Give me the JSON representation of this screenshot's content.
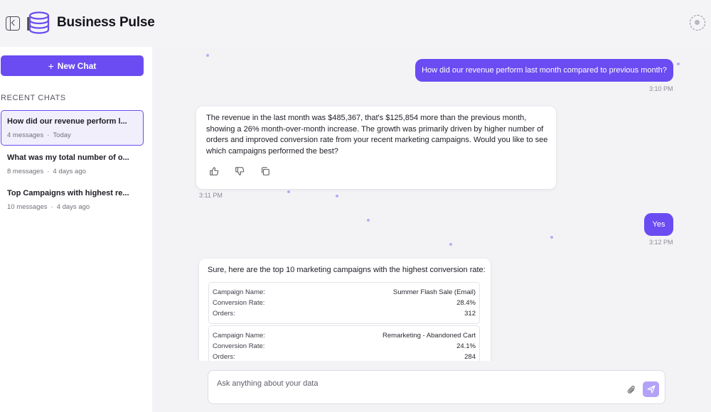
{
  "app": {
    "title": "Business Pulse"
  },
  "sidebar": {
    "new_chat_label": "New Chat",
    "recent_title": "RECENT CHATS",
    "chats": [
      {
        "title": "How did our revenue perform l...",
        "messages": "4 messages",
        "when": "Today",
        "active": true
      },
      {
        "title": "What was my total number of o...",
        "messages": "8 messages",
        "when": "4 days ago",
        "active": false
      },
      {
        "title": "Top Campaigns with highest re...",
        "messages": "10 messages",
        "when": "4 days ago",
        "active": false
      }
    ]
  },
  "conversation": {
    "msg1": {
      "text": "How did our revenue perform last month compared to previous month?",
      "time": "3:10 PM"
    },
    "msg2": {
      "text": "The revenue in the last month was $485,367, that's $125,854 more than the previous month, showing a 26% month-over-month increase. The growth was primarily driven by higher number of orders and improved conversion rate from your recent marketing campaigns. Would you like to see which campaigns performed the best?",
      "time": "3:11 PM"
    },
    "msg3": {
      "text": "Yes",
      "time": "3:12 PM"
    },
    "msg4": {
      "intro": "Sure, here are the top 10 marketing campaigns with the highest conversion rate:",
      "labels": {
        "name": "Campaign Name:",
        "rate": "Conversion Rate:",
        "orders": "Orders:"
      },
      "campaigns": [
        {
          "name": "Summer Flash Sale (Email)",
          "rate": "28.4%",
          "orders": "312"
        },
        {
          "name": "Remarketing - Abandoned Cart",
          "rate": "24.1%",
          "orders": "284"
        }
      ]
    }
  },
  "input": {
    "placeholder": "Ask anything about your data"
  },
  "colors": {
    "accent": "#6a4cf2",
    "accent_light": "#b3a2f7",
    "background": "#f3f3f6"
  }
}
